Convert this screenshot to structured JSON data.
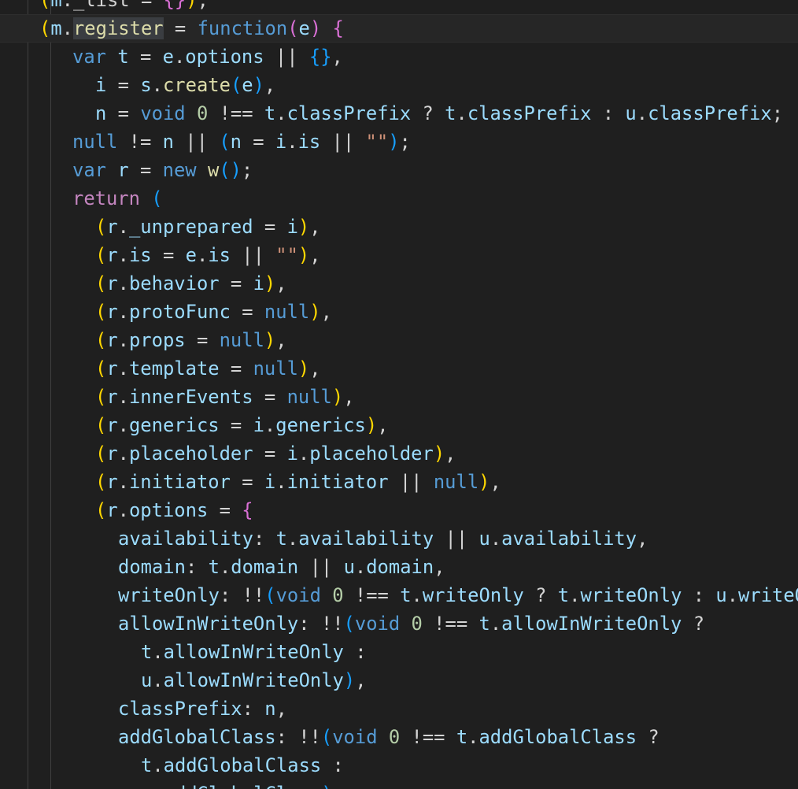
{
  "editor": {
    "language": "JavaScript",
    "theme": "dark",
    "colors": {
      "background": "#1f1f1f",
      "current_line": "#262626",
      "indent_guide": "#404040",
      "plain": "#d4d4d4",
      "variable": "#9cdcfe",
      "keyword": "#569cd6",
      "control": "#c586c0",
      "function": "#dcdcaa",
      "string": "#ce9178",
      "number": "#b5cea8",
      "bracket_1": "#ffd700",
      "bracket_2": "#da70d6",
      "bracket_3": "#179fff"
    },
    "current_line_index": 1,
    "lines": [
      {
        "indent": 1,
        "tokens": [
          [
            "(",
            "bracket_1"
          ],
          [
            "m",
            "variable"
          ],
          [
            "._list = ",
            "plain"
          ],
          [
            "{}",
            "bracket_2"
          ],
          [
            ")",
            "bracket_1"
          ],
          [
            ";",
            "plain"
          ]
        ]
      },
      {
        "indent": 1,
        "tokens": [
          [
            "(",
            "bracket_1"
          ],
          [
            "m",
            "variable"
          ],
          [
            ".",
            "plain"
          ],
          [
            "register",
            "function",
            "selected"
          ],
          [
            " = ",
            "plain"
          ],
          [
            "function",
            "keyword"
          ],
          [
            "(",
            "bracket_2"
          ],
          [
            "e",
            "variable"
          ],
          [
            ")",
            "bracket_2"
          ],
          [
            " ",
            "plain"
          ],
          [
            "{",
            "bracket_2"
          ]
        ]
      },
      {
        "indent": 2,
        "tokens": [
          [
            "var",
            "keyword"
          ],
          [
            " ",
            "plain"
          ],
          [
            "t",
            "variable"
          ],
          [
            " = ",
            "plain"
          ],
          [
            "e",
            "variable"
          ],
          [
            ".",
            "plain"
          ],
          [
            "options",
            "variable"
          ],
          [
            " || ",
            "plain"
          ],
          [
            "{}",
            "bracket_3"
          ],
          [
            ",",
            "plain"
          ]
        ]
      },
      {
        "indent": 3,
        "tokens": [
          [
            "i",
            "variable"
          ],
          [
            " = ",
            "plain"
          ],
          [
            "s",
            "variable"
          ],
          [
            ".",
            "plain"
          ],
          [
            "create",
            "function"
          ],
          [
            "(",
            "bracket_3"
          ],
          [
            "e",
            "variable"
          ],
          [
            ")",
            "bracket_3"
          ],
          [
            ",",
            "plain"
          ]
        ]
      },
      {
        "indent": 3,
        "tokens": [
          [
            "n",
            "variable"
          ],
          [
            " = ",
            "plain"
          ],
          [
            "void",
            "keyword"
          ],
          [
            " ",
            "plain"
          ],
          [
            "0",
            "number"
          ],
          [
            " !== ",
            "plain"
          ],
          [
            "t",
            "variable"
          ],
          [
            ".",
            "plain"
          ],
          [
            "classPrefix",
            "variable"
          ],
          [
            " ? ",
            "plain"
          ],
          [
            "t",
            "variable"
          ],
          [
            ".",
            "plain"
          ],
          [
            "classPrefix",
            "variable"
          ],
          [
            " : ",
            "plain"
          ],
          [
            "u",
            "variable"
          ],
          [
            ".",
            "plain"
          ],
          [
            "classPrefix",
            "variable"
          ],
          [
            ";",
            "plain"
          ]
        ]
      },
      {
        "indent": 2,
        "tokens": [
          [
            "null",
            "keyword"
          ],
          [
            " != ",
            "plain"
          ],
          [
            "n",
            "variable"
          ],
          [
            " || ",
            "plain"
          ],
          [
            "(",
            "bracket_3"
          ],
          [
            "n",
            "variable"
          ],
          [
            " = ",
            "plain"
          ],
          [
            "i",
            "variable"
          ],
          [
            ".",
            "plain"
          ],
          [
            "is",
            "variable"
          ],
          [
            " || ",
            "plain"
          ],
          [
            "\"\"",
            "string"
          ],
          [
            ")",
            "bracket_3"
          ],
          [
            ";",
            "plain"
          ]
        ]
      },
      {
        "indent": 2,
        "tokens": [
          [
            "var",
            "keyword"
          ],
          [
            " ",
            "plain"
          ],
          [
            "r",
            "variable"
          ],
          [
            " = ",
            "plain"
          ],
          [
            "new",
            "keyword"
          ],
          [
            " ",
            "plain"
          ],
          [
            "w",
            "function"
          ],
          [
            "()",
            "bracket_3"
          ],
          [
            ";",
            "plain"
          ]
        ]
      },
      {
        "indent": 2,
        "tokens": [
          [
            "return",
            "control"
          ],
          [
            " ",
            "plain"
          ],
          [
            "(",
            "bracket_3"
          ]
        ]
      },
      {
        "indent": 3,
        "tokens": [
          [
            "(",
            "bracket_1"
          ],
          [
            "r",
            "variable"
          ],
          [
            ".",
            "plain"
          ],
          [
            "_unprepared",
            "variable"
          ],
          [
            " = ",
            "plain"
          ],
          [
            "i",
            "variable"
          ],
          [
            ")",
            "bracket_1"
          ],
          [
            ",",
            "plain"
          ]
        ]
      },
      {
        "indent": 3,
        "tokens": [
          [
            "(",
            "bracket_1"
          ],
          [
            "r",
            "variable"
          ],
          [
            ".",
            "plain"
          ],
          [
            "is",
            "variable"
          ],
          [
            " = ",
            "plain"
          ],
          [
            "e",
            "variable"
          ],
          [
            ".",
            "plain"
          ],
          [
            "is",
            "variable"
          ],
          [
            " || ",
            "plain"
          ],
          [
            "\"\"",
            "string"
          ],
          [
            ")",
            "bracket_1"
          ],
          [
            ",",
            "plain"
          ]
        ]
      },
      {
        "indent": 3,
        "tokens": [
          [
            "(",
            "bracket_1"
          ],
          [
            "r",
            "variable"
          ],
          [
            ".",
            "plain"
          ],
          [
            "behavior",
            "variable"
          ],
          [
            " = ",
            "plain"
          ],
          [
            "i",
            "variable"
          ],
          [
            ")",
            "bracket_1"
          ],
          [
            ",",
            "plain"
          ]
        ]
      },
      {
        "indent": 3,
        "tokens": [
          [
            "(",
            "bracket_1"
          ],
          [
            "r",
            "variable"
          ],
          [
            ".",
            "plain"
          ],
          [
            "protoFunc",
            "variable"
          ],
          [
            " = ",
            "plain"
          ],
          [
            "null",
            "keyword"
          ],
          [
            ")",
            "bracket_1"
          ],
          [
            ",",
            "plain"
          ]
        ]
      },
      {
        "indent": 3,
        "tokens": [
          [
            "(",
            "bracket_1"
          ],
          [
            "r",
            "variable"
          ],
          [
            ".",
            "plain"
          ],
          [
            "props",
            "variable"
          ],
          [
            " = ",
            "plain"
          ],
          [
            "null",
            "keyword"
          ],
          [
            ")",
            "bracket_1"
          ],
          [
            ",",
            "plain"
          ]
        ]
      },
      {
        "indent": 3,
        "tokens": [
          [
            "(",
            "bracket_1"
          ],
          [
            "r",
            "variable"
          ],
          [
            ".",
            "plain"
          ],
          [
            "template",
            "variable"
          ],
          [
            " = ",
            "plain"
          ],
          [
            "null",
            "keyword"
          ],
          [
            ")",
            "bracket_1"
          ],
          [
            ",",
            "plain"
          ]
        ]
      },
      {
        "indent": 3,
        "tokens": [
          [
            "(",
            "bracket_1"
          ],
          [
            "r",
            "variable"
          ],
          [
            ".",
            "plain"
          ],
          [
            "innerEvents",
            "variable"
          ],
          [
            " = ",
            "plain"
          ],
          [
            "null",
            "keyword"
          ],
          [
            ")",
            "bracket_1"
          ],
          [
            ",",
            "plain"
          ]
        ]
      },
      {
        "indent": 3,
        "tokens": [
          [
            "(",
            "bracket_1"
          ],
          [
            "r",
            "variable"
          ],
          [
            ".",
            "plain"
          ],
          [
            "generics",
            "variable"
          ],
          [
            " = ",
            "plain"
          ],
          [
            "i",
            "variable"
          ],
          [
            ".",
            "plain"
          ],
          [
            "generics",
            "variable"
          ],
          [
            ")",
            "bracket_1"
          ],
          [
            ",",
            "plain"
          ]
        ]
      },
      {
        "indent": 3,
        "tokens": [
          [
            "(",
            "bracket_1"
          ],
          [
            "r",
            "variable"
          ],
          [
            ".",
            "plain"
          ],
          [
            "placeholder",
            "variable"
          ],
          [
            " = ",
            "plain"
          ],
          [
            "i",
            "variable"
          ],
          [
            ".",
            "plain"
          ],
          [
            "placeholder",
            "variable"
          ],
          [
            ")",
            "bracket_1"
          ],
          [
            ",",
            "plain"
          ]
        ]
      },
      {
        "indent": 3,
        "tokens": [
          [
            "(",
            "bracket_1"
          ],
          [
            "r",
            "variable"
          ],
          [
            ".",
            "plain"
          ],
          [
            "initiator",
            "variable"
          ],
          [
            " = ",
            "plain"
          ],
          [
            "i",
            "variable"
          ],
          [
            ".",
            "plain"
          ],
          [
            "initiator",
            "variable"
          ],
          [
            " || ",
            "plain"
          ],
          [
            "null",
            "keyword"
          ],
          [
            ")",
            "bracket_1"
          ],
          [
            ",",
            "plain"
          ]
        ]
      },
      {
        "indent": 3,
        "tokens": [
          [
            "(",
            "bracket_1"
          ],
          [
            "r",
            "variable"
          ],
          [
            ".",
            "plain"
          ],
          [
            "options",
            "variable"
          ],
          [
            " = ",
            "plain"
          ],
          [
            "{",
            "bracket_2"
          ]
        ]
      },
      {
        "indent": 4,
        "tokens": [
          [
            "availability",
            "variable"
          ],
          [
            ": ",
            "plain"
          ],
          [
            "t",
            "variable"
          ],
          [
            ".",
            "plain"
          ],
          [
            "availability",
            "variable"
          ],
          [
            " || ",
            "plain"
          ],
          [
            "u",
            "variable"
          ],
          [
            ".",
            "plain"
          ],
          [
            "availability",
            "variable"
          ],
          [
            ",",
            "plain"
          ]
        ]
      },
      {
        "indent": 4,
        "tokens": [
          [
            "domain",
            "variable"
          ],
          [
            ": ",
            "plain"
          ],
          [
            "t",
            "variable"
          ],
          [
            ".",
            "plain"
          ],
          [
            "domain",
            "variable"
          ],
          [
            " || ",
            "plain"
          ],
          [
            "u",
            "variable"
          ],
          [
            ".",
            "plain"
          ],
          [
            "domain",
            "variable"
          ],
          [
            ",",
            "plain"
          ]
        ]
      },
      {
        "indent": 4,
        "tokens": [
          [
            "writeOnly",
            "variable"
          ],
          [
            ": !!",
            "plain"
          ],
          [
            "(",
            "bracket_3"
          ],
          [
            "void",
            "keyword"
          ],
          [
            " ",
            "plain"
          ],
          [
            "0",
            "number"
          ],
          [
            " !== ",
            "plain"
          ],
          [
            "t",
            "variable"
          ],
          [
            ".",
            "plain"
          ],
          [
            "writeOnly",
            "variable"
          ],
          [
            " ? ",
            "plain"
          ],
          [
            "t",
            "variable"
          ],
          [
            ".",
            "plain"
          ],
          [
            "writeOnly",
            "variable"
          ],
          [
            " : ",
            "plain"
          ],
          [
            "u",
            "variable"
          ],
          [
            ".",
            "plain"
          ],
          [
            "writeOnly",
            "variable"
          ],
          [
            ")",
            "bracket_3"
          ],
          [
            ",",
            "plain"
          ]
        ]
      },
      {
        "indent": 4,
        "tokens": [
          [
            "allowInWriteOnly",
            "variable"
          ],
          [
            ": !!",
            "plain"
          ],
          [
            "(",
            "bracket_3"
          ],
          [
            "void",
            "keyword"
          ],
          [
            " ",
            "plain"
          ],
          [
            "0",
            "number"
          ],
          [
            " !== ",
            "plain"
          ],
          [
            "t",
            "variable"
          ],
          [
            ".",
            "plain"
          ],
          [
            "allowInWriteOnly",
            "variable"
          ],
          [
            " ?",
            "plain"
          ]
        ]
      },
      {
        "indent": 5,
        "tokens": [
          [
            "t",
            "variable"
          ],
          [
            ".",
            "plain"
          ],
          [
            "allowInWriteOnly",
            "variable"
          ],
          [
            " :",
            "plain"
          ]
        ]
      },
      {
        "indent": 5,
        "tokens": [
          [
            "u",
            "variable"
          ],
          [
            ".",
            "plain"
          ],
          [
            "allowInWriteOnly",
            "variable"
          ],
          [
            ")",
            "bracket_3"
          ],
          [
            ",",
            "plain"
          ]
        ]
      },
      {
        "indent": 4,
        "tokens": [
          [
            "classPrefix",
            "variable"
          ],
          [
            ": ",
            "plain"
          ],
          [
            "n",
            "variable"
          ],
          [
            ",",
            "plain"
          ]
        ]
      },
      {
        "indent": 4,
        "tokens": [
          [
            "addGlobalClass",
            "variable"
          ],
          [
            ": !!",
            "plain"
          ],
          [
            "(",
            "bracket_3"
          ],
          [
            "void",
            "keyword"
          ],
          [
            " ",
            "plain"
          ],
          [
            "0",
            "number"
          ],
          [
            " !== ",
            "plain"
          ],
          [
            "t",
            "variable"
          ],
          [
            ".",
            "plain"
          ],
          [
            "addGlobalClass",
            "variable"
          ],
          [
            " ?",
            "plain"
          ]
        ]
      },
      {
        "indent": 5,
        "tokens": [
          [
            "t",
            "variable"
          ],
          [
            ".",
            "plain"
          ],
          [
            "addGlobalClass",
            "variable"
          ],
          [
            " :",
            "plain"
          ]
        ]
      },
      {
        "indent": 5,
        "tokens": [
          [
            "u",
            "variable"
          ],
          [
            ".",
            "plain"
          ],
          [
            "addGlobalClass",
            "variable"
          ],
          [
            ")",
            "bracket_3"
          ],
          [
            ",",
            "plain"
          ]
        ]
      }
    ]
  }
}
